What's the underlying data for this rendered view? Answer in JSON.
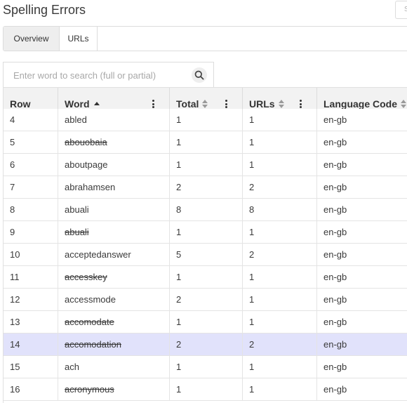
{
  "page": {
    "title": "Spelling Errors",
    "top_search_placeholder": "S"
  },
  "tabs": [
    {
      "label": "Overview",
      "active": true
    },
    {
      "label": "URLs",
      "active": false
    }
  ],
  "search": {
    "placeholder": "Enter word to search (full or partial)",
    "value": ""
  },
  "table": {
    "columns": [
      {
        "label": "Row",
        "sort": "none"
      },
      {
        "label": "Word",
        "sort": "asc"
      },
      {
        "label": "Total",
        "sort": "both"
      },
      {
        "label": "URLs",
        "sort": "both"
      },
      {
        "label": "Language Code",
        "sort": "both"
      }
    ],
    "rows": [
      {
        "row": "4",
        "word": "abled",
        "total": "1",
        "urls": "1",
        "lang": "en-gb",
        "struck": false
      },
      {
        "row": "5",
        "word": "abouobaia",
        "total": "1",
        "urls": "1",
        "lang": "en-gb",
        "struck": true
      },
      {
        "row": "6",
        "word": "aboutpage",
        "total": "1",
        "urls": "1",
        "lang": "en-gb",
        "struck": false
      },
      {
        "row": "7",
        "word": "abrahamsen",
        "total": "2",
        "urls": "2",
        "lang": "en-gb",
        "struck": false
      },
      {
        "row": "8",
        "word": "abuali",
        "total": "8",
        "urls": "8",
        "lang": "en-gb",
        "struck": false
      },
      {
        "row": "9",
        "word": "abuali",
        "total": "1",
        "urls": "1",
        "lang": "en-gb",
        "struck": true
      },
      {
        "row": "10",
        "word": "acceptedanswer",
        "total": "5",
        "urls": "2",
        "lang": "en-gb",
        "struck": false
      },
      {
        "row": "11",
        "word": "accesskey",
        "total": "1",
        "urls": "1",
        "lang": "en-gb",
        "struck": true
      },
      {
        "row": "12",
        "word": "accessmode",
        "total": "2",
        "urls": "1",
        "lang": "en-gb",
        "struck": false
      },
      {
        "row": "13",
        "word": "accomodate",
        "total": "1",
        "urls": "1",
        "lang": "en-gb",
        "struck": true
      },
      {
        "row": "14",
        "word": "accomodation",
        "total": "2",
        "urls": "2",
        "lang": "en-gb",
        "struck": true,
        "selected": true
      },
      {
        "row": "15",
        "word": "ach",
        "total": "1",
        "urls": "1",
        "lang": "en-gb",
        "struck": false
      },
      {
        "row": "16",
        "word": "acronymous",
        "total": "1",
        "urls": "1",
        "lang": "en-gb",
        "struck": true
      }
    ]
  },
  "colors": {
    "selected_row": "#e1e2fb",
    "header_bg": "#f2f2f2",
    "active_tab_bg": "#eeeeee"
  },
  "icons": {
    "search": "search-icon",
    "column_menu": "kebab-menu-icon",
    "sort_ascending": "sort-asc-icon",
    "sortable": "sort-both-icon"
  }
}
